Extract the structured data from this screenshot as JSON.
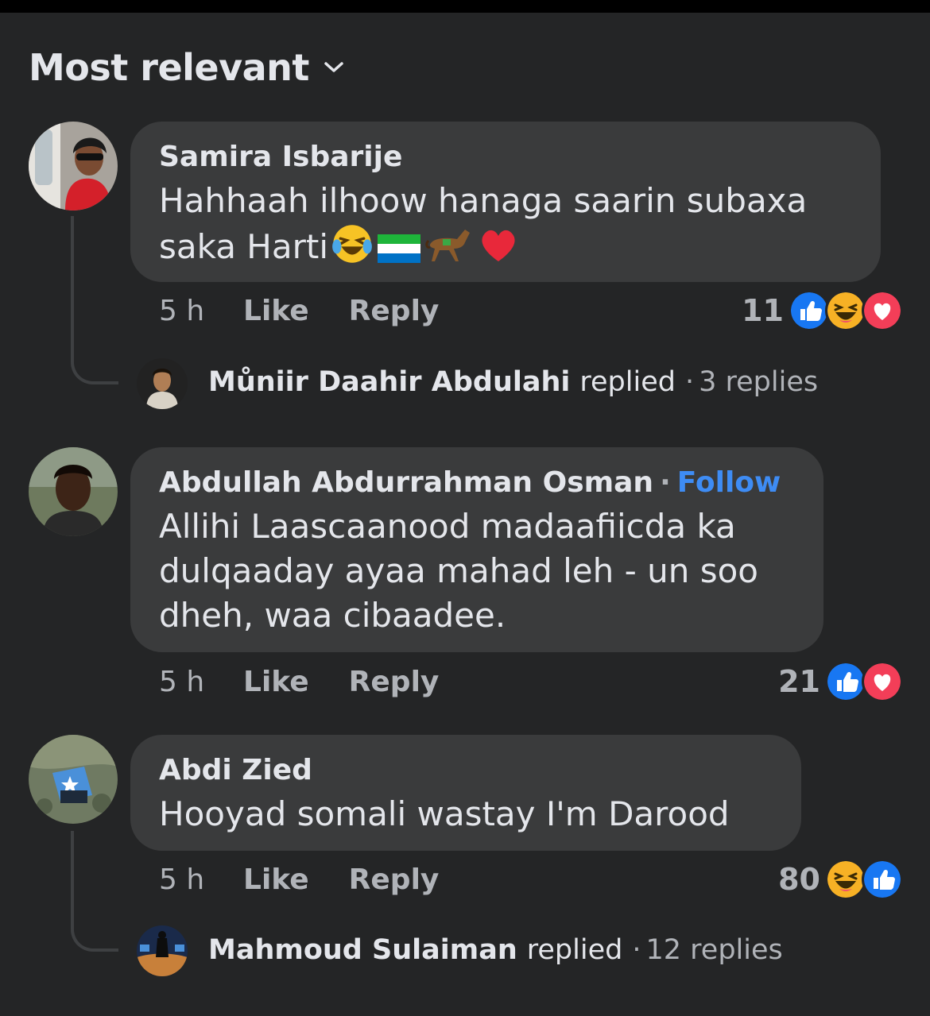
{
  "sort": {
    "label": "Most relevant"
  },
  "comments": [
    {
      "author": "Samira Isbarije",
      "text_lines": [
        "Hahhaah ilhoow hanaga saarin subaxa",
        "saka Harti"
      ],
      "emojis": [
        "laughing-tears-emoji",
        "sierra-leone-flag-emoji",
        "horse-emoji",
        "red-heart-emoji"
      ],
      "time": "5 h",
      "like": "Like",
      "reply": "Reply",
      "reaction_count": "11",
      "reactions": [
        "like",
        "haha",
        "love"
      ],
      "replied": {
        "name": "Můniir Daahir Abdulahi",
        "verb": "replied",
        "sep": "·",
        "count": "3 replies"
      }
    },
    {
      "author": "Abdullah Abdurrahman Osman",
      "follow": "Follow",
      "sep": "·",
      "text_lines": [
        "Allihi Laascaanood madaafiicda ka",
        "dulqaaday ayaa mahad leh - un soo",
        "dheh, waa cibaadee."
      ],
      "time": "5 h",
      "like": "Like",
      "reply": "Reply",
      "reaction_count": "21",
      "reactions": [
        "like",
        "love"
      ]
    },
    {
      "author": "Abdi Zied",
      "text_lines": [
        "Hooyad somali wastay I'm Darood"
      ],
      "time": "5 h",
      "like": "Like",
      "reply": "Reply",
      "reaction_count": "80",
      "reactions": [
        "haha",
        "like"
      ],
      "replied": {
        "name": "Mahmoud Sulaiman",
        "verb": "replied",
        "sep": "·",
        "count": "12 replies"
      }
    }
  ],
  "colors": {
    "background": "#242526",
    "bubble": "#3a3b3c",
    "text": "#e4e6eb",
    "secondary": "#b0b3b8",
    "follow": "#3e8cf4",
    "like_blue": "#1877f2",
    "love_red": "#f33e58",
    "haha_yellow": "#f7b125"
  }
}
